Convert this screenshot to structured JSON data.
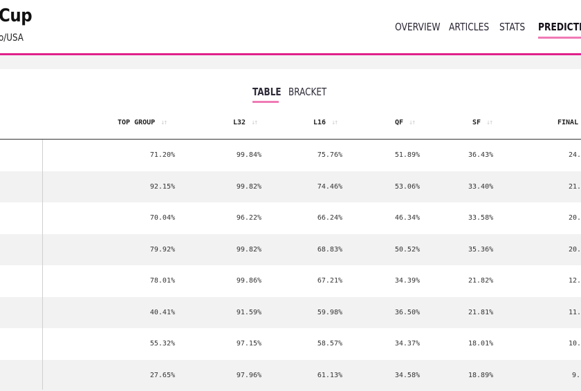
{
  "header": {
    "title": "Cup",
    "subtitle": "o/USA",
    "nav": [
      {
        "label": "OVERVIEW",
        "active": false
      },
      {
        "label": "ARTICLES",
        "active": false
      },
      {
        "label": "STATS",
        "active": false
      },
      {
        "label": "PREDICTIO",
        "active": true
      }
    ]
  },
  "view_toggle": {
    "table_label": "TABLE",
    "bracket_label": "BRACKET",
    "selected": "TABLE"
  },
  "table": {
    "columns": [
      "TOP GROUP",
      "L32",
      "L16",
      "QF",
      "SF",
      "FINAL"
    ],
    "rows": [
      [
        "71.20%",
        "99.84%",
        "75.76%",
        "51.89%",
        "36.43%",
        "24."
      ],
      [
        "92.15%",
        "99.82%",
        "74.46%",
        "53.06%",
        "33.40%",
        "21."
      ],
      [
        "70.04%",
        "96.22%",
        "66.24%",
        "46.34%",
        "33.58%",
        "20."
      ],
      [
        "79.92%",
        "99.82%",
        "68.83%",
        "50.52%",
        "35.36%",
        "20."
      ],
      [
        "78.01%",
        "99.86%",
        "67.21%",
        "34.39%",
        "21.82%",
        "12."
      ],
      [
        "40.41%",
        "91.59%",
        "59.98%",
        "36.50%",
        "21.81%",
        "11."
      ],
      [
        "55.32%",
        "97.15%",
        "58.57%",
        "34.37%",
        "18.01%",
        "10."
      ],
      [
        "27.65%",
        "97.96%",
        "61.13%",
        "34.58%",
        "18.89%",
        "9."
      ]
    ]
  },
  "colors": {
    "accent": "#e0218a",
    "underline": "#f07ab5",
    "row_alt": "#f2f2f2"
  },
  "icons": {
    "sort": "sort-arrows-icon"
  }
}
